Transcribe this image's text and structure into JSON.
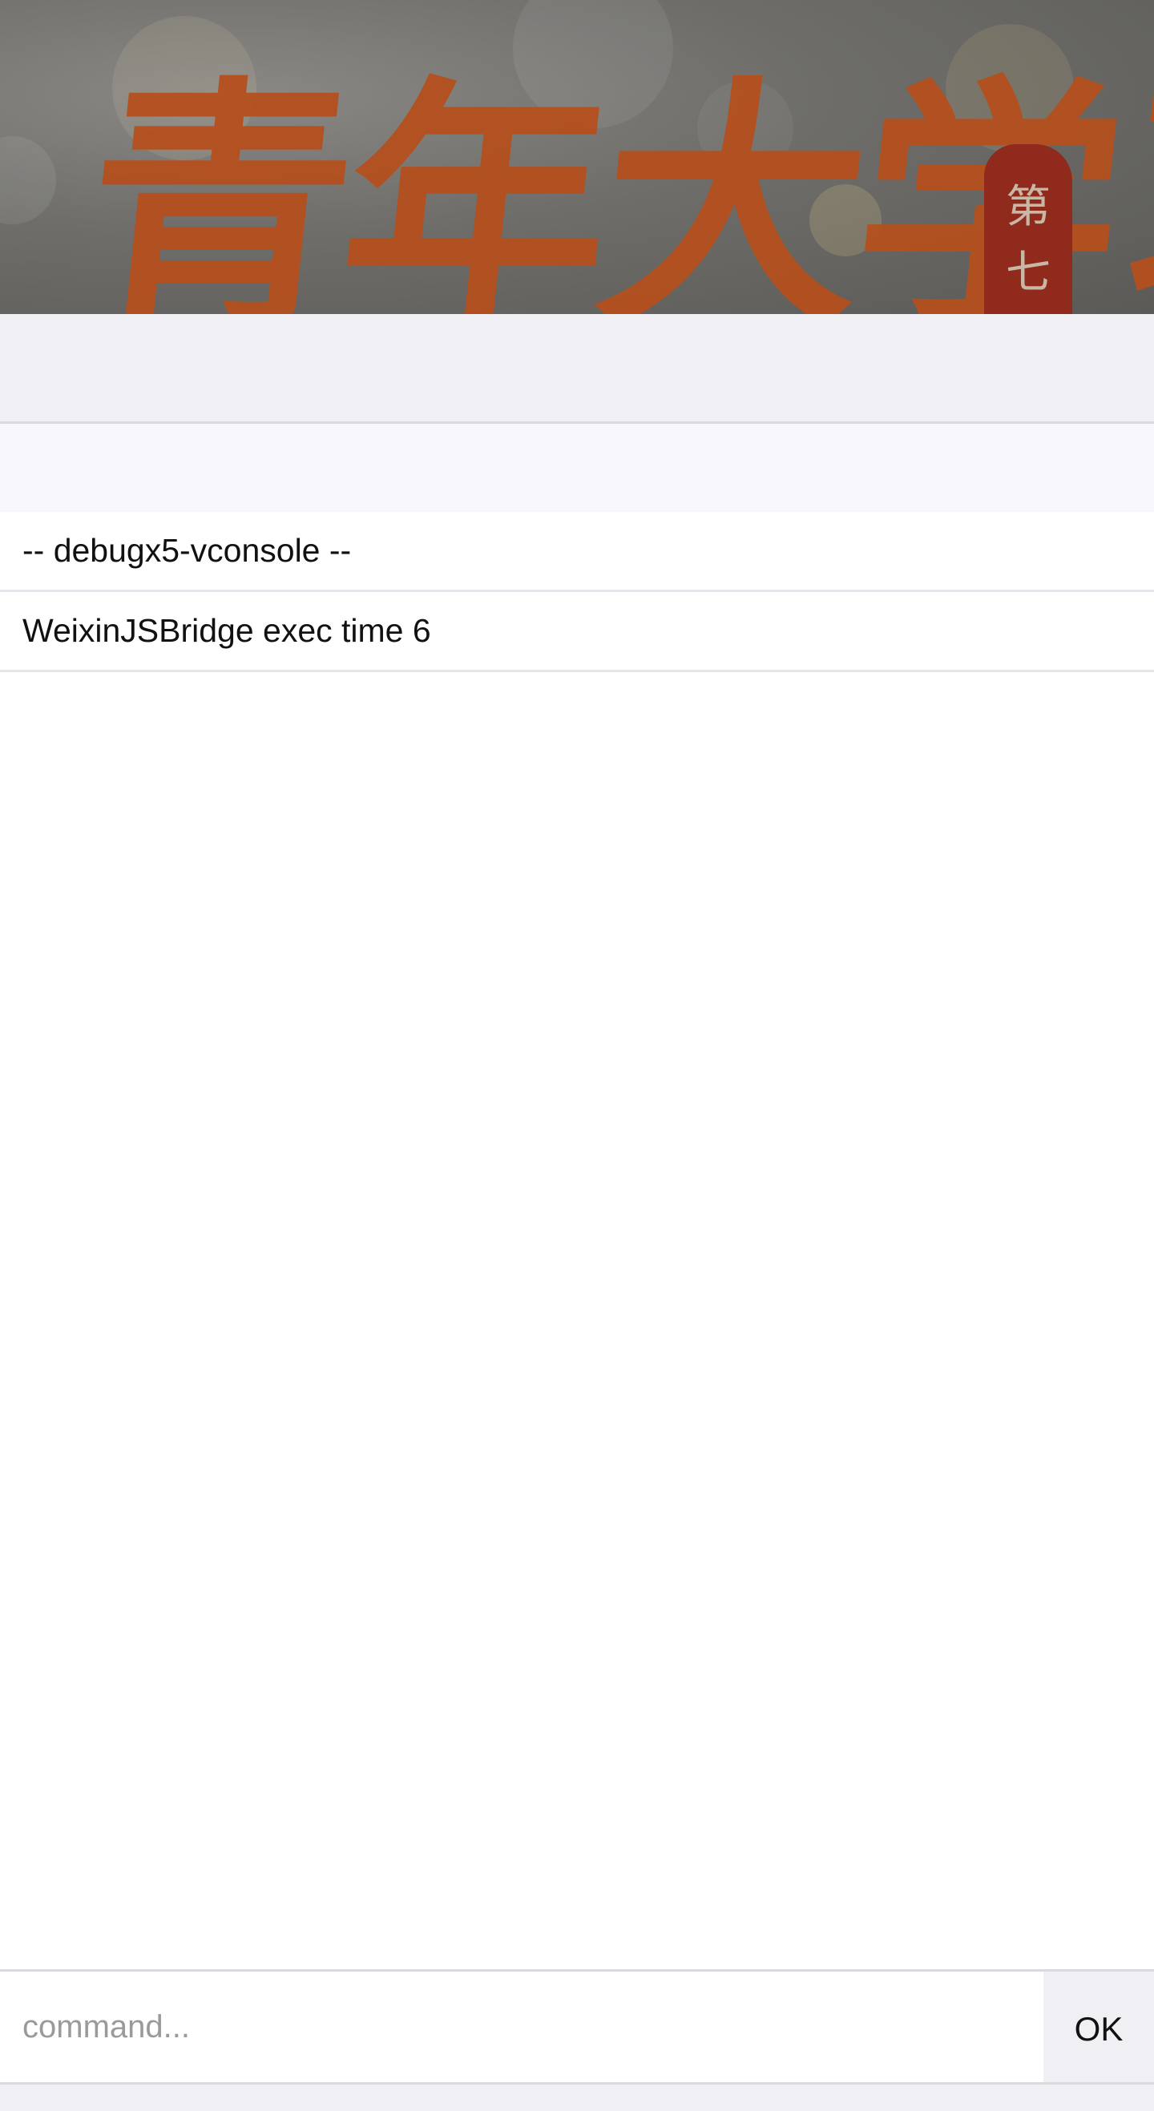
{
  "background_page": {
    "banner_calligraphy": "青年大学习",
    "seal_text": [
      "第",
      "七"
    ]
  },
  "console": {
    "log_lines": [
      "-- debugx5-vconsole --",
      "WeixinJSBridge exec time 6"
    ],
    "command_input": {
      "placeholder": "command...",
      "value": ""
    },
    "ok_button_label": "OK"
  }
}
